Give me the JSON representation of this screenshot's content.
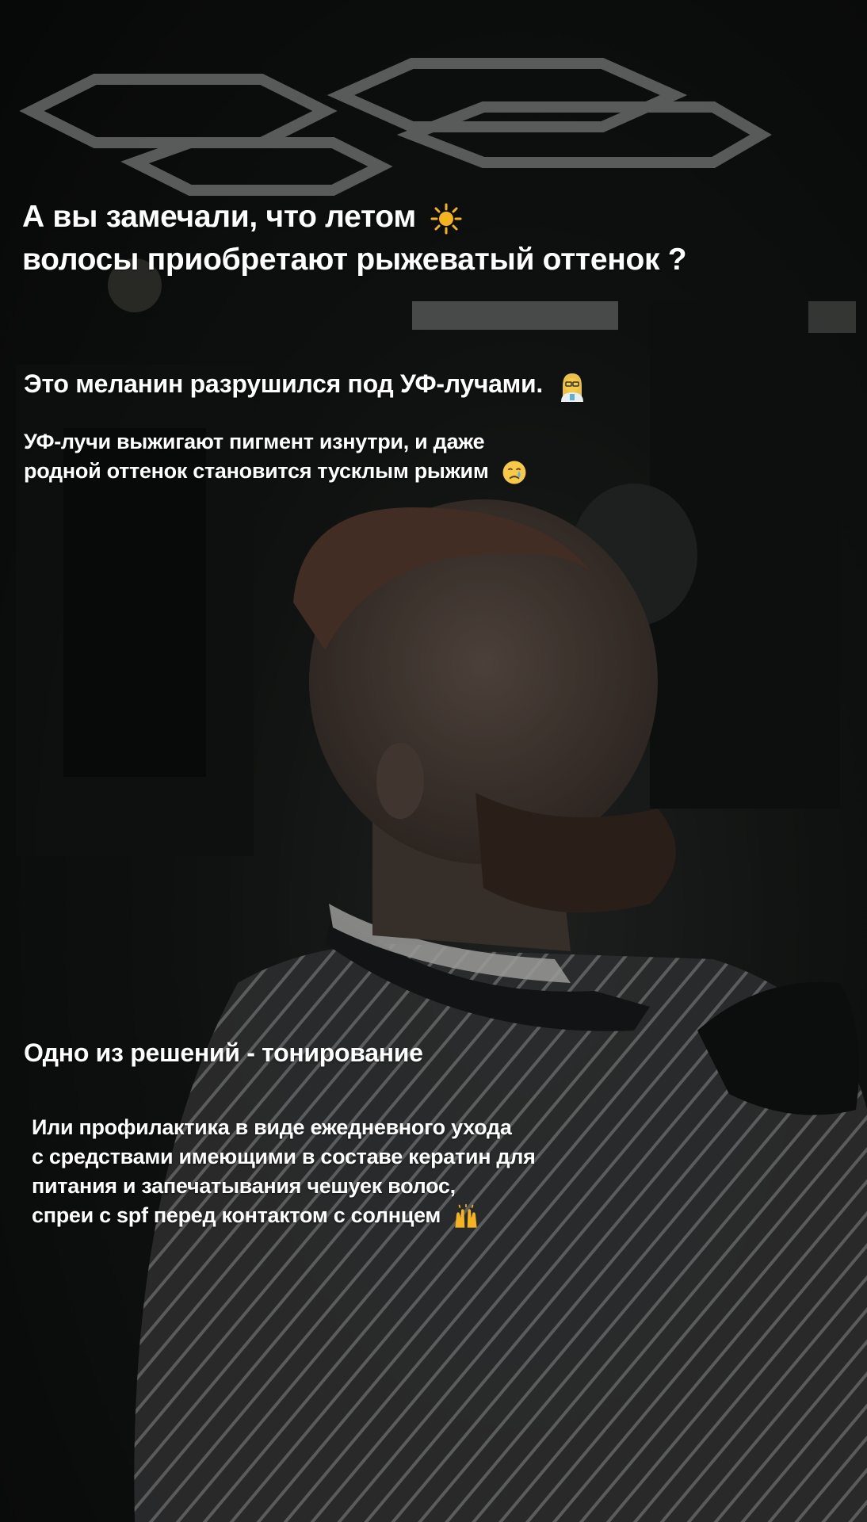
{
  "story": {
    "heading": {
      "line1": "А вы замечали,  что летом",
      "line2": "волосы приобретают рыжеватый оттенок ?",
      "icon": "sun-icon"
    },
    "section1": {
      "title": "Это меланин разрушился под УФ-лучами.",
      "title_icon": "scientist-woman-icon",
      "body_line1": "УФ-лучи выжигают пигмент изнутри, и даже",
      "body_line2": "родной оттенок становится  тусклым  рыжим",
      "body_icon": "crying-face-icon"
    },
    "section2": {
      "title": "Одно из решений - тонирование",
      "body_line1": "Или профилактика  в виде ежедневного ухода",
      "body_line2": "с средствами имеющими в составе кератин для",
      "body_line3": "питания и запечатывания чешуек волос,",
      "body_line4": "спреи с spf перед контактом с солнцем",
      "body_icon": "raised-hands-icon"
    }
  },
  "colors": {
    "text": "#ffffff",
    "background": "#0d0f0f",
    "sun": "#f5b41f",
    "emoji_face": "#f7c948"
  }
}
